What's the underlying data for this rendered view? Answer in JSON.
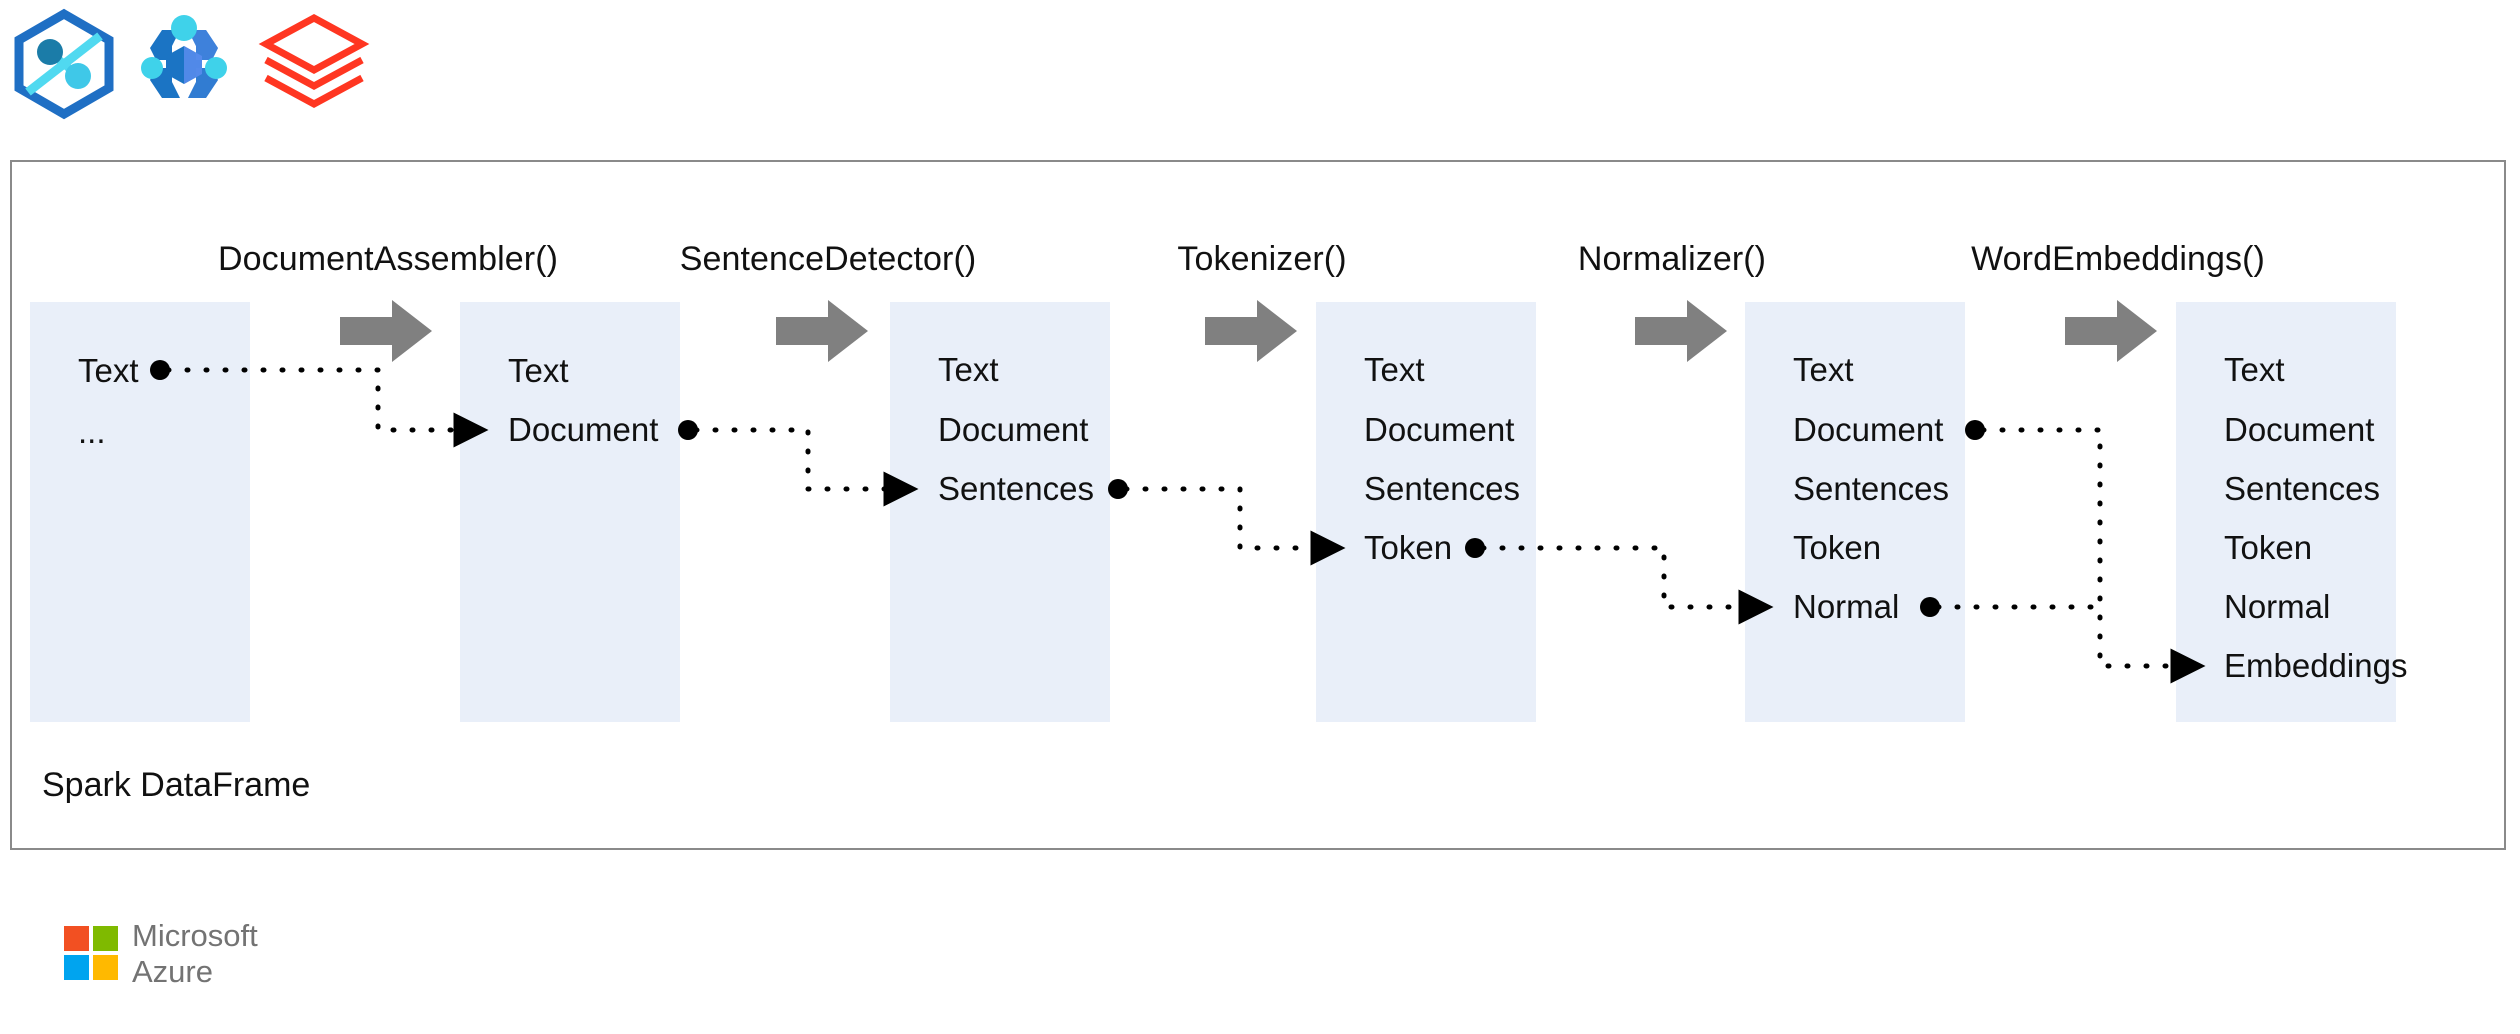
{
  "logos": {
    "synapse": "azure-synapse-analytics-logo",
    "machine_learning": "azure-machine-learning-logo",
    "databricks": "databricks-logo"
  },
  "panel": {
    "caption": "Spark DataFrame"
  },
  "stages": [
    {
      "label": "",
      "box_name": "input-dataframe",
      "fields": [
        "Text",
        "..."
      ]
    },
    {
      "label": "DocumentAssembler()",
      "box_name": "document-assembler-dataframe",
      "fields": [
        "Text",
        "Document"
      ]
    },
    {
      "label": "SentenceDetector()",
      "box_name": "sentence-detector-dataframe",
      "fields": [
        "Text",
        "Document",
        "Sentences"
      ]
    },
    {
      "label": "Tokenizer()",
      "box_name": "tokenizer-dataframe",
      "fields": [
        "Text",
        "Document",
        "Sentences",
        "Token"
      ]
    },
    {
      "label": "Normalizer()",
      "box_name": "normalizer-dataframe",
      "fields": [
        "Text",
        "Document",
        "Sentences",
        "Token",
        "Normal"
      ]
    },
    {
      "label": "WordEmbeddings()",
      "box_name": "word-embeddings-dataframe",
      "fields": [
        "Text",
        "Document",
        "Sentences",
        "Token",
        "Normal",
        "Embeddings"
      ]
    }
  ],
  "footer": {
    "brand_line_1": "Microsoft",
    "brand_line_2": "Azure"
  },
  "colors": {
    "box_fill": "#e9eff9",
    "panel_border": "#8a8a8a",
    "arrow_gray": "#808080",
    "connector": "#000000",
    "text": "#111111",
    "azure_red": "#f25022",
    "azure_green": "#7fba00",
    "azure_blue": "#00a4ef",
    "azure_yellow": "#ffb900",
    "azure_text": "#737373",
    "databricks_red": "#ff3621",
    "synapse_blue": "#1f6fc4",
    "synapse_cyan": "#50d9f0"
  }
}
